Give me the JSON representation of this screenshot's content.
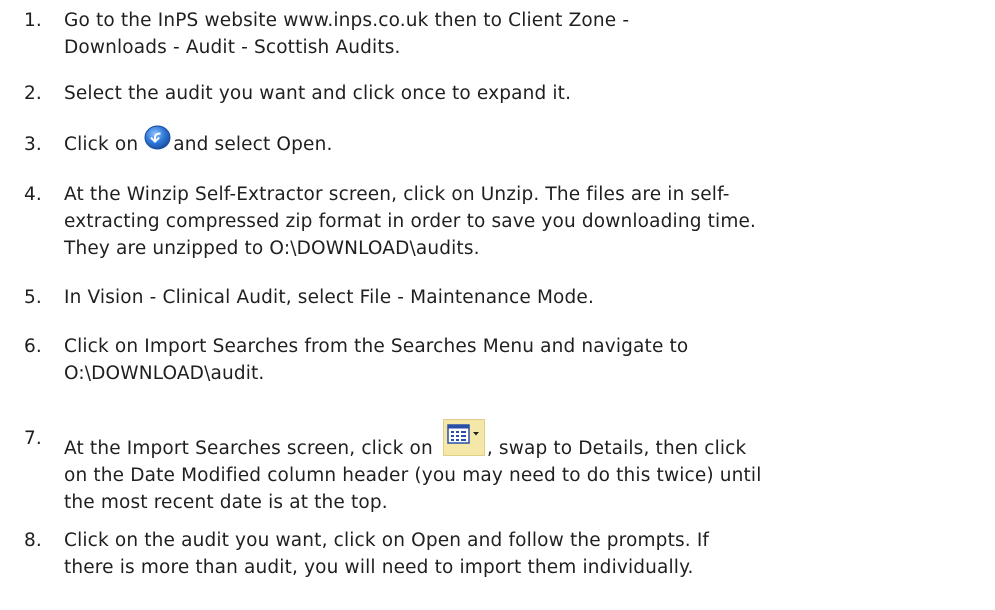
{
  "steps": [
    {
      "number": "1.",
      "lines": [
        "Go to the InPS website www.inps.co.uk then to Client Zone -",
        "Downloads - Audit - Scottish Audits."
      ]
    },
    {
      "number": "2.",
      "lines": [
        "Select the audit you want and click once to expand it."
      ]
    },
    {
      "number": "3.",
      "before_icon": "Click on ",
      "icon": "blue-back-arrow-icon",
      "after_icon": "and select Open."
    },
    {
      "number": "4.",
      "lines": [
        "At the Winzip Self-Extractor screen, click on Unzip.  The files are in self-",
        "extracting compressed zip format in order to save you downloading time.",
        "They are unzipped to O:\\DOWNLOAD\\audits."
      ]
    },
    {
      "number": "5.",
      "lines": [
        "In Vision - Clinical Audit, select File - Maintenance Mode."
      ]
    },
    {
      "number": "6.",
      "lines": [
        "Click on Import Searches from the Searches Menu and navigate to",
        "O:\\DOWNLOAD\\audit."
      ]
    },
    {
      "number": "7.",
      "before_icon": "At the Import Searches screen, click on ",
      "icon": "view-menu-icon",
      "after_icon": ", swap to Details, then click",
      "lines": [
        "on the Date Modified column header (you may need to do this twice) until",
        "the most recent date is at the top."
      ]
    },
    {
      "number": "8.",
      "lines": [
        "Click on the audit you want, click on Open and follow the prompts.  If",
        "there is more than audit, you will need to import them individually."
      ]
    }
  ],
  "colors": {
    "text": "#1f1f1f",
    "back_icon": "#2f78d8",
    "view_icon_bg": "#f4e7a8"
  }
}
